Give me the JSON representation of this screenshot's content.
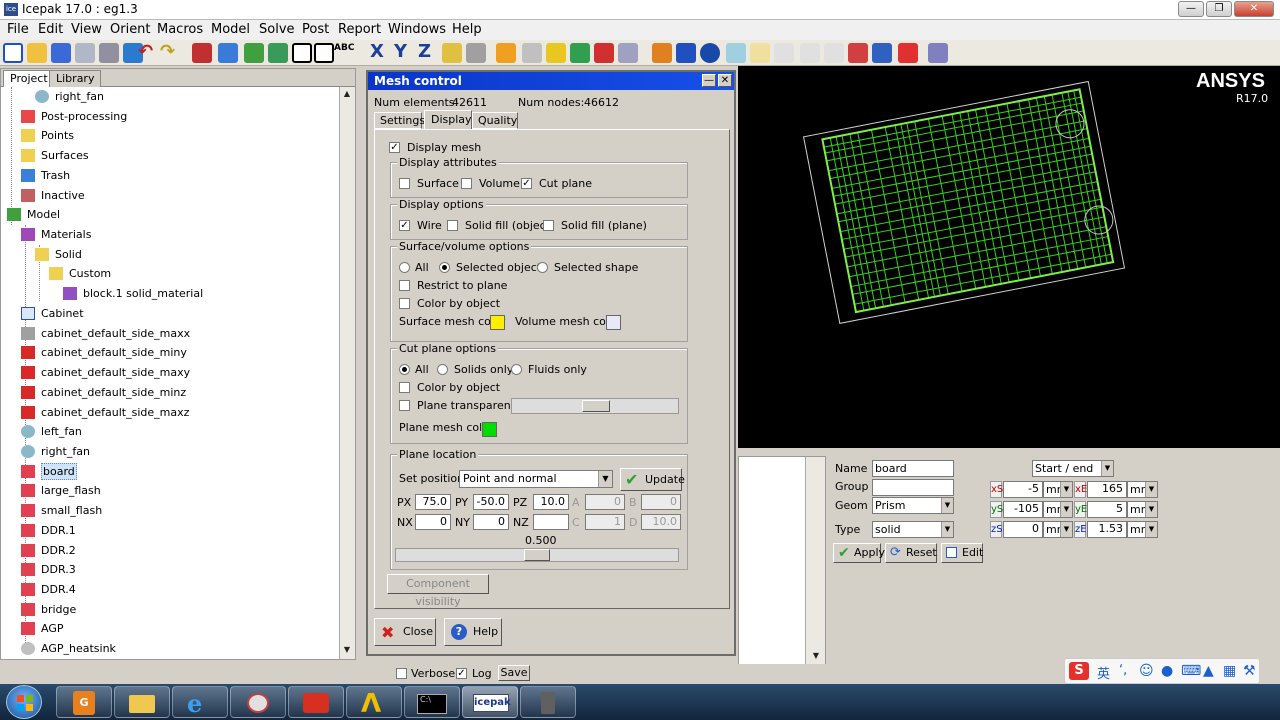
{
  "window": {
    "title": "Icepak 17.0 : eg1.3",
    "app_icon_text": "Icepak"
  },
  "menu": [
    "File",
    "Edit",
    "View",
    "Orient",
    "Macros",
    "Model",
    "Solve",
    "Post",
    "Report",
    "Windows",
    "Help"
  ],
  "toolbar": {
    "axis_labels": [
      "X",
      "Y",
      "Z"
    ],
    "abc_label": "ABC"
  },
  "tree": {
    "tabs": [
      "Project",
      "Library"
    ],
    "items": [
      {
        "label": "right_fan",
        "icon": "fan-icon"
      },
      {
        "label": "Post-processing",
        "icon": "postprocessing-icon"
      },
      {
        "label": "Points",
        "icon": "folder-icon"
      },
      {
        "label": "Surfaces",
        "icon": "folder-icon"
      },
      {
        "label": "Trash",
        "icon": "trash-icon"
      },
      {
        "label": "Inactive",
        "icon": "inactive-icon"
      },
      {
        "label": "Model",
        "icon": "model-icon"
      },
      {
        "label": "Materials",
        "icon": "materials-icon"
      },
      {
        "label": "Solid",
        "icon": "folder-icon"
      },
      {
        "label": "Custom",
        "icon": "folder-icon"
      },
      {
        "label": "block.1 solid_material",
        "icon": "material-icon"
      },
      {
        "label": "Cabinet",
        "icon": "cabinet-icon"
      },
      {
        "label": "cabinet_default_side_maxx",
        "icon": "wall-gray-icon"
      },
      {
        "label": "cabinet_default_side_miny",
        "icon": "wall-red-icon"
      },
      {
        "label": "cabinet_default_side_maxy",
        "icon": "wall-red-icon"
      },
      {
        "label": "cabinet_default_side_minz",
        "icon": "wall-red-icon"
      },
      {
        "label": "cabinet_default_side_maxz",
        "icon": "wall-red-icon"
      },
      {
        "label": "left_fan",
        "icon": "fan-icon"
      },
      {
        "label": "right_fan",
        "icon": "fan-icon"
      },
      {
        "label": "board",
        "icon": "block-icon"
      },
      {
        "label": "large_flash",
        "icon": "block-icon"
      },
      {
        "label": "small_flash",
        "icon": "block-icon"
      },
      {
        "label": "DDR.1",
        "icon": "block-icon"
      },
      {
        "label": "DDR.2",
        "icon": "block-icon"
      },
      {
        "label": "DDR.3",
        "icon": "block-icon"
      },
      {
        "label": "DDR.4",
        "icon": "block-icon"
      },
      {
        "label": "bridge",
        "icon": "block-icon"
      },
      {
        "label": "AGP",
        "icon": "block-icon"
      },
      {
        "label": "AGP_heatsink",
        "icon": "heatsink-icon"
      }
    ]
  },
  "mesh_dialog": {
    "title": "Mesh control",
    "num_elements_label": "Num elements:",
    "num_elements": "42611",
    "num_nodes_label": "Num nodes:",
    "num_nodes": "46612",
    "tabs": [
      "Settings",
      "Display",
      "Quality"
    ],
    "active_tab": "Display",
    "display_mesh": "Display mesh",
    "attributes": {
      "title": "Display attributes",
      "surface": "Surface",
      "volume": "Volume",
      "cut_plane": "Cut plane"
    },
    "options": {
      "title": "Display options",
      "wire": "Wire",
      "solid_object": "Solid fill (object)",
      "solid_plane": "Solid fill (plane)"
    },
    "surfvol": {
      "title": "Surface/volume options",
      "all": "All",
      "selected_object": "Selected object",
      "selected_shape": "Selected shape",
      "restrict": "Restrict to plane",
      "color_by_object": "Color by object",
      "surface_color_label": "Surface mesh color",
      "volume_color_label": "Volume mesh color",
      "surface_color": "#ffee00",
      "volume_color": "#e8e8f8"
    },
    "cutplane": {
      "title": "Cut plane options",
      "all": "All",
      "solids": "Solids only",
      "fluids": "Fluids only",
      "color_by_object": "Color by object",
      "transparency": "Plane transparency",
      "plane_mesh_color_label": "Plane mesh color",
      "plane_mesh_color": "#00dd00"
    },
    "planeloc": {
      "title": "Plane location",
      "set_position_label": "Set position",
      "set_position": "Point and normal",
      "update": "Update",
      "labels": {
        "px": "PX",
        "py": "PY",
        "pz": "PZ",
        "a": "A",
        "b": "B",
        "nx": "NX",
        "ny": "NY",
        "nz": "NZ",
        "c": "C",
        "d": "D"
      },
      "px": "75.0",
      "py": "-50.0",
      "pz": "10.0",
      "a": "0",
      "b": "0",
      "nx": "0",
      "ny": "0",
      "nz": "",
      "c": "1",
      "d": "10.0",
      "slider_value": "0.500"
    },
    "component_visibility": "Component visibility",
    "close": "Close",
    "help": "Help"
  },
  "viewport": {
    "brand": "ANSYS",
    "version": "R17.0"
  },
  "properties": {
    "name_label": "Name",
    "name": "board",
    "group_label": "Group",
    "group": "",
    "geom_label": "Geom",
    "geom": "Prism",
    "type_label": "Type",
    "type": "solid",
    "mode": "Start / end",
    "xs": "-5",
    "xe": "165",
    "ys": "-105",
    "ye": "5",
    "zs": "0",
    "ze": "1.53",
    "unit": "mm",
    "axis_labels": {
      "xs": "xS",
      "xe": "xE",
      "ys": "yS",
      "ye": "yE",
      "zs": "zS",
      "ze": "zE"
    },
    "apply": "Apply",
    "reset": "Reset",
    "edit": "Edit"
  },
  "log": {
    "verbose": "Verbose",
    "log": "Log",
    "save": "Save"
  },
  "ime": {
    "chars": "英"
  },
  "taskbar": {
    "icepak_label": "icepak"
  }
}
